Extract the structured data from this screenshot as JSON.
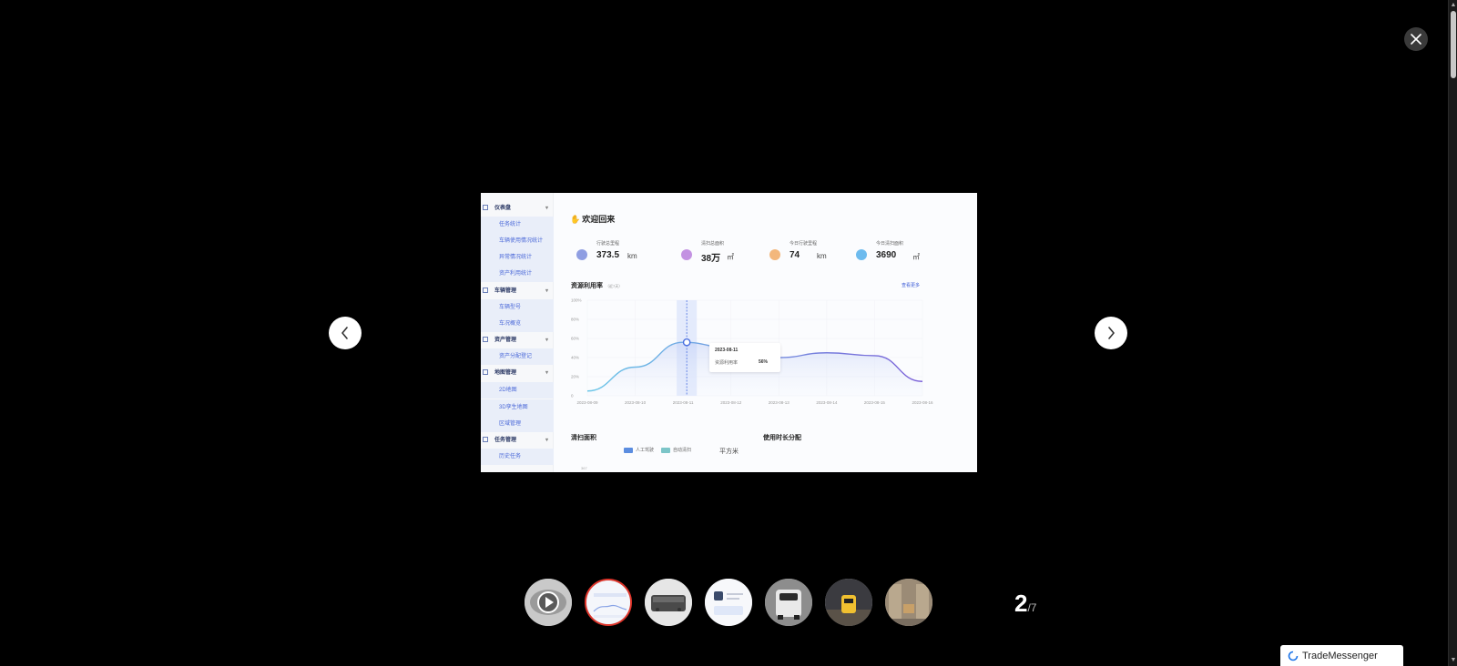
{
  "gallery": {
    "current": "2",
    "total": "/7"
  },
  "screenshot": {
    "sidebar": [
      {
        "kind": "group",
        "label": "仪表盘"
      },
      {
        "kind": "sub",
        "label": "任务统计"
      },
      {
        "kind": "sub",
        "label": "车辆使用情况统计"
      },
      {
        "kind": "sub",
        "label": "异常情况统计"
      },
      {
        "kind": "sub",
        "label": "资产利用统计"
      },
      {
        "kind": "group",
        "label": "车辆管理"
      },
      {
        "kind": "sub",
        "label": "车辆型号"
      },
      {
        "kind": "sub",
        "label": "车况概览"
      },
      {
        "kind": "group",
        "label": "资产管理"
      },
      {
        "kind": "sub",
        "label": "资产分配登记"
      },
      {
        "kind": "group",
        "label": "地图管理"
      },
      {
        "kind": "sub",
        "label": "2D地图"
      },
      {
        "kind": "sub",
        "label": "3D孪生地图"
      },
      {
        "kind": "sub",
        "label": "区域管理"
      },
      {
        "kind": "group",
        "label": "任务管理"
      },
      {
        "kind": "sub",
        "label": "历史任务"
      }
    ],
    "welcome": "欢迎回来",
    "stats": [
      {
        "label": "行驶总里程",
        "value": "373.5",
        "unit": "km",
        "color": "#6b7fd8"
      },
      {
        "label": "清扫总面积",
        "value": "38万",
        "unit": "㎡",
        "color": "#b06fd8"
      },
      {
        "label": "今日行驶里程",
        "value": "74",
        "unit": "km",
        "color": "#f0a050"
      },
      {
        "label": "今日清扫面积",
        "value": "3690",
        "unit": "㎡",
        "color": "#3da5e8"
      }
    ],
    "chart_title": "资源利用率",
    "chart_subtitle": "（近7天）",
    "chart_more": "查看更多",
    "tooltip": {
      "date": "2023-08-11",
      "label": "资源利用率",
      "value": "56%"
    },
    "bottom_left_title": "清扫面积",
    "legend": [
      {
        "label": "人工驾驶",
        "color": "#5b8de0"
      },
      {
        "label": "自动清扫",
        "color": "#7cc5c8"
      }
    ],
    "bottom_unit": "平方米",
    "bottom_right_title": "使用时长分配",
    "bottom_axis_tick": "367"
  },
  "chart_data": {
    "type": "area",
    "title": "资源利用率",
    "x": [
      "2023-08-09",
      "2023-08-10",
      "2023-08-11",
      "2023-08-12",
      "2023-08-13",
      "2023-08-14",
      "2023-08-15",
      "2023-08-16"
    ],
    "series": [
      {
        "values": [
          5,
          30,
          56,
          50,
          40,
          45,
          42,
          15
        ]
      }
    ],
    "y_ticks": [
      "0",
      "20%",
      "40%",
      "60%",
      "80%",
      "100%"
    ],
    "ylim": [
      0,
      100
    ],
    "highlight_index": 2,
    "grid": true
  },
  "thumbnails": [
    {
      "name": "video-thumb",
      "kind": "video"
    },
    {
      "name": "dashboard-thumb",
      "kind": "dashboard"
    },
    {
      "name": "device-thumb",
      "kind": "device"
    },
    {
      "name": "app-thumb",
      "kind": "app"
    },
    {
      "name": "vehicle-thumb",
      "kind": "vehicle"
    },
    {
      "name": "robot-scene-thumb",
      "kind": "scene"
    },
    {
      "name": "warehouse-thumb",
      "kind": "warehouse"
    }
  ],
  "trade_messenger": "TradeMessenger",
  "colors": {
    "accent": "#3b5bd6",
    "active_thumb_border": "#e0352b"
  }
}
